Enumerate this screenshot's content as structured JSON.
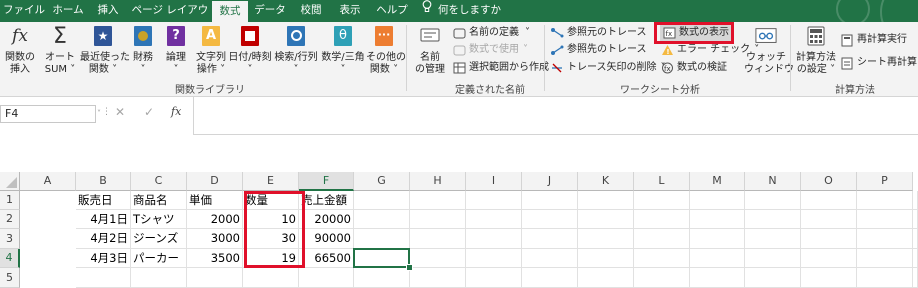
{
  "tabs": [
    "ファイル",
    "ホーム",
    "挿入",
    "ページ レイアウト",
    "数式",
    "データ",
    "校閲",
    "表示",
    "ヘルプ"
  ],
  "active_tab": "数式",
  "tell_me": "何をしますか",
  "ribbon": {
    "function_library": {
      "insert_function": [
        "関数の",
        "挿入"
      ],
      "autosum": [
        "オート",
        "SUM ˅"
      ],
      "recent": [
        "最近使った",
        "関数 ˅"
      ],
      "financial": [
        "財務",
        "˅"
      ],
      "logical": [
        "論理",
        "˅"
      ],
      "text": [
        "文字列",
        "操作 ˅"
      ],
      "datetime": [
        "日付/時刻",
        "˅"
      ],
      "lookup": [
        "検索/行列",
        "˅"
      ],
      "math": [
        "数学/三角",
        "˅"
      ],
      "more": [
        "その他の",
        "関数 ˅"
      ],
      "group_label": "関数ライブラリ"
    },
    "defined_names": {
      "name_manager": [
        "名前",
        "の管理"
      ],
      "define_name": "名前の定義",
      "use_in_formula": "数式で使用",
      "create_from_selection": "選択範囲から作成",
      "group_label": "定義された名前"
    },
    "formula_auditing": {
      "trace_precedents": "参照元のトレース",
      "trace_dependents": "参照先のトレース",
      "remove_arrows": "トレース矢印の削除",
      "show_formulas": "数式の表示",
      "error_checking": "エラー チェック",
      "evaluate_formula": "数式の検証",
      "watch_window": [
        "ウォッチ",
        "ウィンドウ"
      ],
      "group_label": "ワークシート分析"
    },
    "calculation": {
      "calc_options": [
        "計算方法",
        "の設定 ˅"
      ],
      "calc_now": "再計算実行",
      "calc_sheet": "シート再計算",
      "group_label": "計算方法"
    }
  },
  "name_box": "F4",
  "formula_bar": {
    "cancel": "✕",
    "enter": "✓",
    "fx": "fx",
    "content": ""
  },
  "columns": [
    "A",
    "B",
    "C",
    "D",
    "E",
    "F",
    "G",
    "H",
    "I",
    "J",
    "K",
    "L",
    "M",
    "N",
    "O",
    "P"
  ],
  "selected_column": "F",
  "rows": [
    "1",
    "2",
    "3",
    "4",
    "5"
  ],
  "selected_row": "4",
  "cells": {
    "A1": "販売日",
    "B1": "商品名",
    "C1": "単価",
    "D1": "数量",
    "E1": "売上金額",
    "A2": "4月1日",
    "B2": "Tシャツ",
    "C2": "2000",
    "D2": "10",
    "E2": "20000",
    "A3": "4月2日",
    "B3": "ジーンズ",
    "C3": "3000",
    "D3": "30",
    "E3": "90000",
    "A4": "4月3日",
    "B4": "パーカー",
    "C4": "3500",
    "D4": "19",
    "E4": "66500"
  },
  "colors": {
    "excel_green": "#217346",
    "highlight_red": "#e0102a"
  }
}
